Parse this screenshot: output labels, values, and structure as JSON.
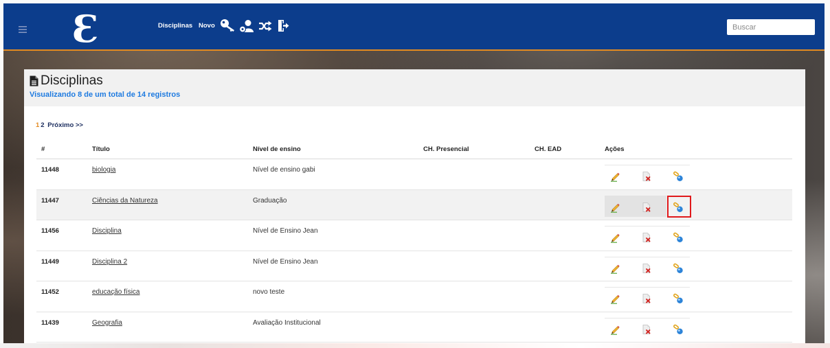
{
  "header": {
    "menu_icon": "menu-icon",
    "logo_text": "Ɛ",
    "nav": [
      {
        "label": "Disciplinas"
      },
      {
        "label": "Novo"
      }
    ],
    "nav_icons": [
      "key-icon",
      "user-settings-icon",
      "shuffle-icon",
      "exit-icon"
    ],
    "search_placeholder": "Buscar"
  },
  "panel": {
    "title_icon": "file-icon",
    "title": "Disciplinas",
    "subtitle": "Visualizando 8 de um total de 14 registros"
  },
  "pagination": {
    "current_page": "1",
    "other_page": "2",
    "next_label": "Próximo >>"
  },
  "table": {
    "columns": [
      "#",
      "Título",
      "Nível de ensino",
      "CH. Presencial",
      "CH. EAD",
      "Ações"
    ],
    "rows": [
      {
        "id": "11448",
        "title": "biologia",
        "level": "Nível de ensino gabi",
        "ch_presencial": "",
        "ch_ead": "",
        "actions": [
          "edit-icon",
          "delete-icon",
          "link-icon"
        ]
      },
      {
        "id": "11447",
        "title": "Ciências da Natureza",
        "level": "Graduação",
        "ch_presencial": "",
        "ch_ead": "",
        "actions": [
          "edit-icon",
          "delete-icon",
          "link-icon"
        ],
        "hovered": true,
        "highlight_box": "link-icon"
      },
      {
        "id": "11456",
        "title": "Disciplina",
        "level": "Nível de Ensino Jean",
        "ch_presencial": "",
        "ch_ead": "",
        "actions": [
          "edit-icon",
          "delete-icon",
          "link-icon"
        ]
      },
      {
        "id": "11449",
        "title": "Disciplina 2",
        "level": "Nível de Ensino Jean",
        "ch_presencial": "",
        "ch_ead": "",
        "actions": [
          "edit-icon",
          "delete-icon",
          "link-icon"
        ]
      },
      {
        "id": "11452",
        "title": "educação física",
        "level": "novo teste",
        "ch_presencial": "",
        "ch_ead": "",
        "actions": [
          "edit-icon",
          "delete-icon",
          "link-icon"
        ]
      },
      {
        "id": "11439",
        "title": "Geografia",
        "level": "Avaliação Institucional",
        "ch_presencial": "",
        "ch_ead": "",
        "actions": [
          "edit-icon",
          "delete-icon",
          "link-icon"
        ]
      }
    ]
  },
  "colors": {
    "header_bg": "#0c3d8c",
    "header_accent": "#e38b22",
    "subtitle_text": "#1f7be0",
    "current_page": "#e38b22",
    "pagination_link": "#1b2d5e",
    "row_hover": "#f2f2f2",
    "annotation_box": "#e0191b"
  }
}
